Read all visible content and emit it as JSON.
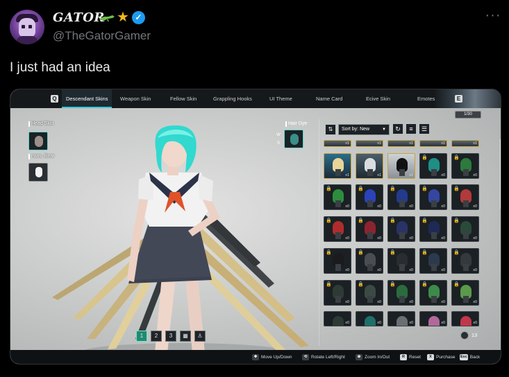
{
  "tweet": {
    "display_name": "GATOR",
    "handle": "@TheGatorGamer",
    "text": "I just had an idea",
    "more_icon": "ellipsis-icon",
    "verified_color": "#1d9bf0"
  },
  "game": {
    "tabs": [
      {
        "label": "Descendant Skins",
        "active": true
      },
      {
        "label": "Weapon Skin",
        "active": false
      },
      {
        "label": "Fellow Skin",
        "active": false
      },
      {
        "label": "Grappling Hooks",
        "active": false
      },
      {
        "label": "UI Theme",
        "active": false
      },
      {
        "label": "Name Card",
        "active": false
      },
      {
        "label": "Ecive Skin",
        "active": false
      },
      {
        "label": "Emotes",
        "active": false
      }
    ],
    "tab_key_left": "Q",
    "tab_key_right": "E",
    "left_panel": {
      "head_skin_label": "Head Skin",
      "brows_label": "rows, Bear"
    },
    "hair_dye": {
      "label": "Hair Dye",
      "key_w": "W",
      "key_s": "S"
    },
    "variants": [
      "1",
      "2",
      "3"
    ],
    "sort": {
      "label": "Sort by: New"
    },
    "owned_counter": "1/30",
    "page_count": "13",
    "accent_color": "#39c6d6",
    "hints": [
      {
        "key": "◆",
        "label": "Move Up/Down"
      },
      {
        "key": "◆",
        "label": "Rotate Left/Right"
      },
      {
        "key": "◆",
        "label": "Zoom In/Out"
      },
      {
        "key": "R",
        "label": "Reset"
      },
      {
        "key": "X",
        "label": "Purchase"
      },
      {
        "key": "Esc",
        "label": "Back"
      }
    ],
    "grid_qty": {
      "r0": [
        "x1",
        "x1",
        "x1",
        "x1",
        "x1"
      ],
      "r1": [
        "x1",
        "x1",
        "x1",
        "x0",
        "x0"
      ],
      "r2": [
        "x0",
        "x0",
        "x0",
        "x0",
        "x0"
      ],
      "r3": [
        "x0",
        "x0",
        "x0",
        "x0",
        "x0"
      ],
      "r4": [
        "x0",
        "x0",
        "x0",
        "x0",
        "x0"
      ],
      "r5": [
        "x0",
        "x0",
        "x0",
        "x0",
        "x0"
      ],
      "r6": [
        "x0",
        "x0",
        "x0",
        "x0",
        "x0"
      ]
    }
  }
}
